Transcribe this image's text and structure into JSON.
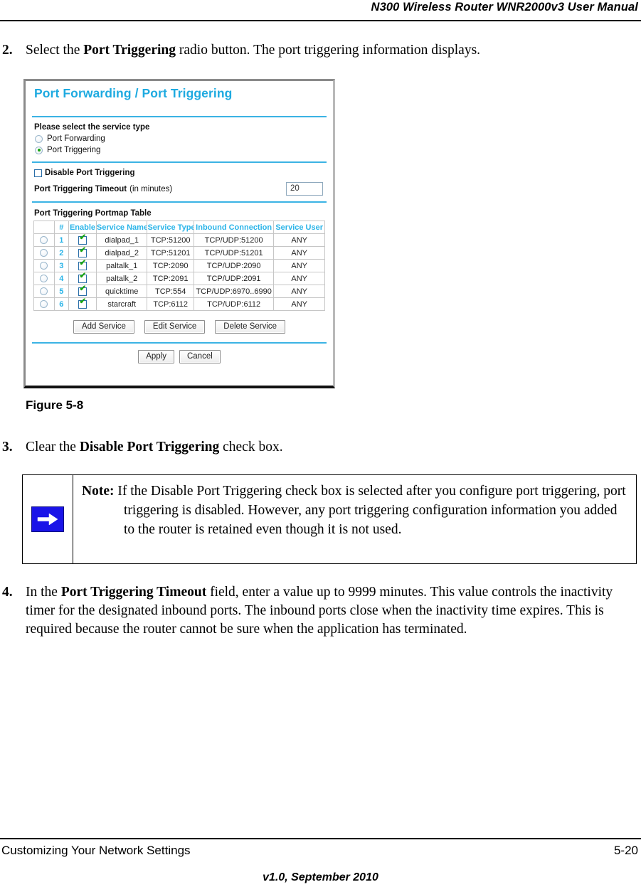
{
  "header": {
    "title": "N300 Wireless Router WNR2000v3 User Manual"
  },
  "steps": {
    "step2": {
      "number": "2.",
      "text_before": "Select the ",
      "bold": "Port Triggering",
      "text_after": " radio button. The port triggering information displays."
    },
    "step3": {
      "number": "3.",
      "text_before": "Clear the ",
      "bold": "Disable Port Triggering",
      "text_after": " check box."
    },
    "step4": {
      "number": "4.",
      "text_before": "In the ",
      "bold": "Port Triggering Timeout",
      "text_after": " field, enter a value up to 9999 minutes. This value controls the inactivity timer for the designated inbound ports. The inbound ports close when the inactivity time expires. This is required because the router cannot be sure when the application has terminated."
    }
  },
  "figure": {
    "caption": "Figure 5-8",
    "screenshot": {
      "title": "Port Forwarding / Port Triggering",
      "service_type_label": "Please select the service type",
      "radios": [
        {
          "label": "Port Forwarding",
          "selected": false
        },
        {
          "label": "Port Triggering",
          "selected": true
        }
      ],
      "disable_checkbox": {
        "label": "Disable Port Triggering",
        "checked": false
      },
      "timeout": {
        "label_bold": "Port Triggering Timeout",
        "label_normal": "(in minutes)",
        "value": "20"
      },
      "table_title": "Port Triggering Portmap Table",
      "table": {
        "columns": [
          "",
          "#",
          "Enable",
          "Service Name",
          "Service Type",
          "Inbound Connection",
          "Service User"
        ],
        "rows": [
          {
            "select": false,
            "index": "1",
            "enable": true,
            "service_name": "dialpad_1",
            "service_type": "TCP:51200",
            "inbound_connection": "TCP/UDP:51200",
            "service_user": "ANY"
          },
          {
            "select": false,
            "index": "2",
            "enable": true,
            "service_name": "dialpad_2",
            "service_type": "TCP:51201",
            "inbound_connection": "TCP/UDP:51201",
            "service_user": "ANY"
          },
          {
            "select": false,
            "index": "3",
            "enable": true,
            "service_name": "paltalk_1",
            "service_type": "TCP:2090",
            "inbound_connection": "TCP/UDP:2090",
            "service_user": "ANY"
          },
          {
            "select": false,
            "index": "4",
            "enable": true,
            "service_name": "paltalk_2",
            "service_type": "TCP:2091",
            "inbound_connection": "TCP/UDP:2091",
            "service_user": "ANY"
          },
          {
            "select": false,
            "index": "5",
            "enable": true,
            "service_name": "quicktime",
            "service_type": "TCP:554",
            "inbound_connection": "TCP/UDP:6970..6990",
            "service_user": "ANY"
          },
          {
            "select": false,
            "index": "6",
            "enable": true,
            "service_name": "starcraft",
            "service_type": "TCP:6112",
            "inbound_connection": "TCP/UDP:6112",
            "service_user": "ANY"
          }
        ]
      },
      "service_buttons": [
        "Add Service",
        "Edit Service",
        "Delete Service"
      ],
      "form_buttons": [
        "Apply",
        "Cancel"
      ],
      "colors": {
        "title_blue": "#1eaae0",
        "rule_blue": "#3bb3e4",
        "table_header_text": "#2ab4e8",
        "check_green": "#16a30e",
        "checkbox_border": "#2a6ea8"
      }
    }
  },
  "note": {
    "icon": "right-arrow-icon",
    "icon_color": "#1a14e8",
    "label": "Note:",
    "body": "If the Disable Port Triggering check box is selected after you configure port triggering, port triggering is disabled. However, any port triggering configuration information you added to the router is retained even though it is not used."
  },
  "footer": {
    "left": "Customizing Your Network Settings",
    "page": "5-20",
    "version": "v1.0, September 2010"
  }
}
